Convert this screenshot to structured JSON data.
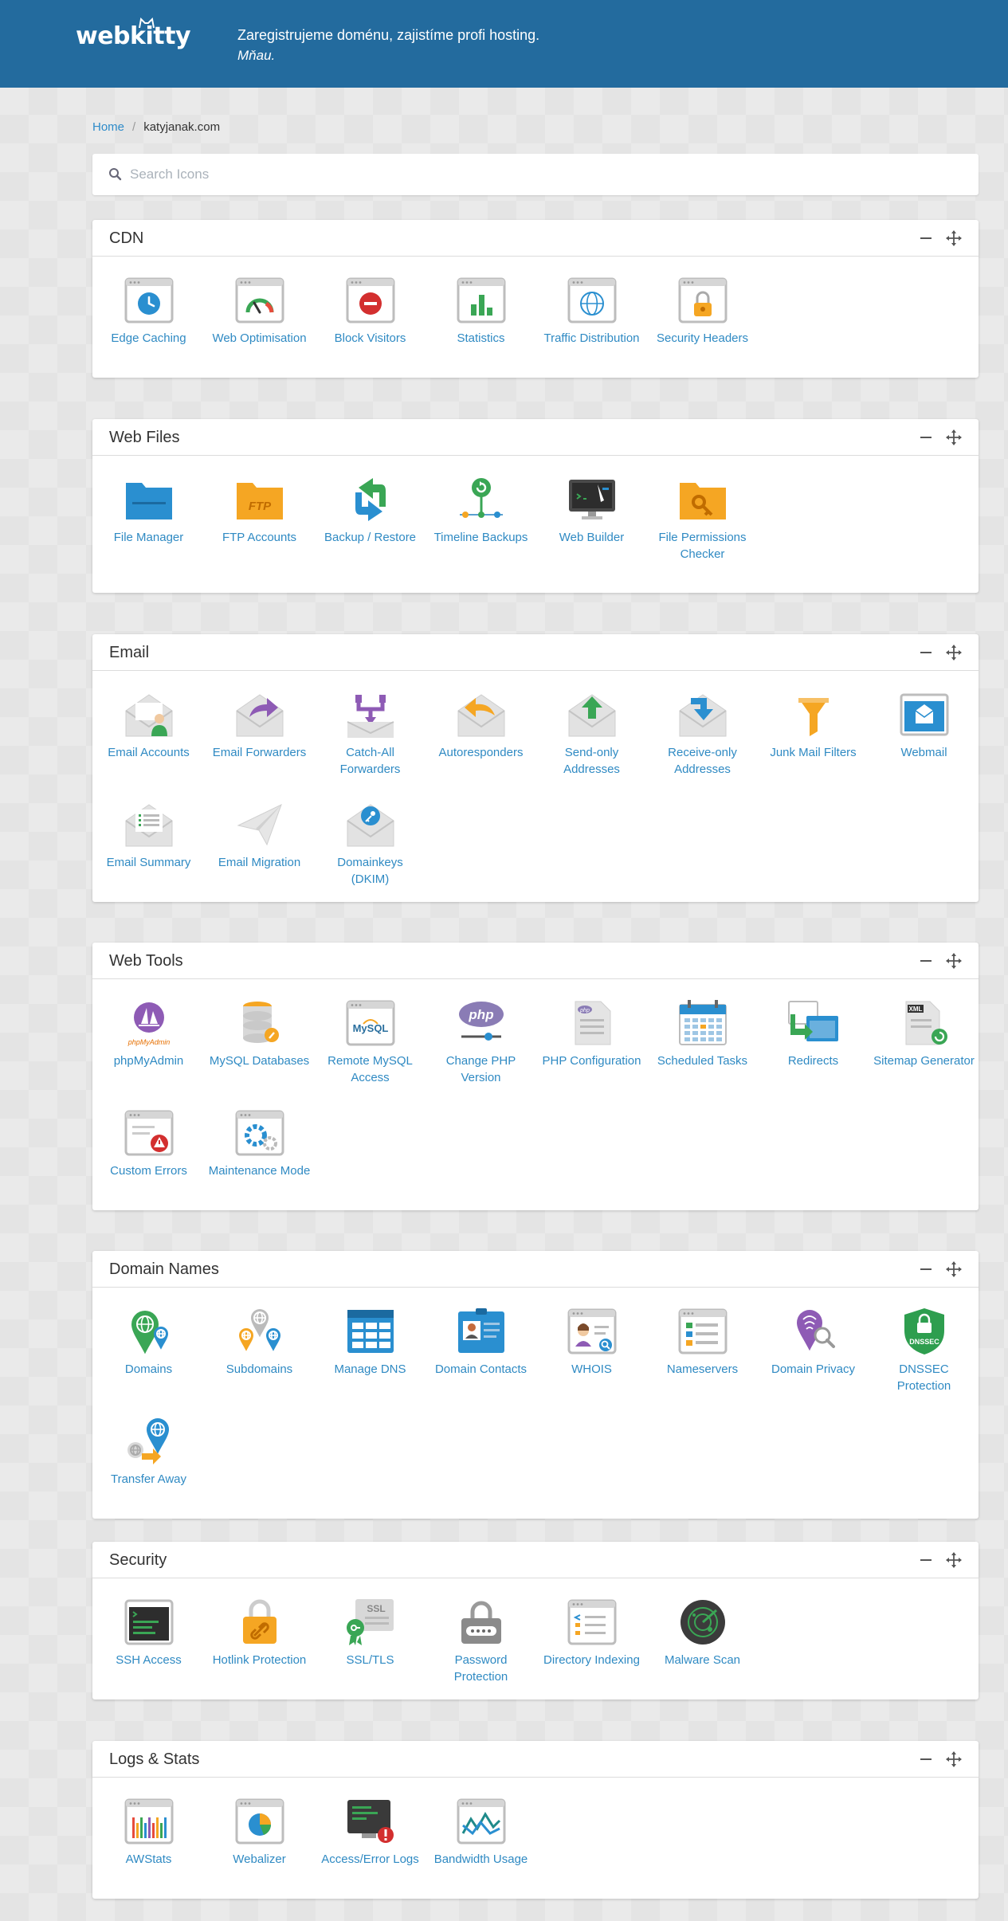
{
  "header": {
    "logo_text": "webkitty",
    "tagline_line1": "Zaregistrujeme doménu, zajistíme profi hosting.",
    "tagline_line2": "Mňau."
  },
  "breadcrumb": {
    "home": "Home",
    "current": "katyjanak.com"
  },
  "search": {
    "placeholder": "Search Icons",
    "value": ""
  },
  "sections": [
    {
      "title": "CDN",
      "items": [
        {
          "label": "Edge Caching",
          "icon": "edge-caching-icon"
        },
        {
          "label": "Web Optimisation",
          "icon": "web-optimisation-icon"
        },
        {
          "label": "Block Visitors",
          "icon": "block-visitors-icon"
        },
        {
          "label": "Statistics",
          "icon": "statistics-icon"
        },
        {
          "label": "Traffic Distribution",
          "icon": "traffic-distribution-icon"
        },
        {
          "label": "Security Headers",
          "icon": "security-headers-icon"
        }
      ]
    },
    {
      "title": "Web Files",
      "items": [
        {
          "label": "File Manager",
          "icon": "file-manager-icon"
        },
        {
          "label": "FTP Accounts",
          "icon": "ftp-accounts-icon"
        },
        {
          "label": "Backup / Restore",
          "icon": "backup-restore-icon"
        },
        {
          "label": "Timeline Backups",
          "icon": "timeline-backups-icon"
        },
        {
          "label": "Web Builder",
          "icon": "web-builder-icon"
        },
        {
          "label": "File Permissions Checker",
          "icon": "file-permissions-icon"
        }
      ]
    },
    {
      "title": "Email",
      "items": [
        {
          "label": "Email Accounts",
          "icon": "email-accounts-icon"
        },
        {
          "label": "Email Forwarders",
          "icon": "email-forwarders-icon"
        },
        {
          "label": "Catch-All Forwarders",
          "icon": "catch-all-icon"
        },
        {
          "label": "Autoresponders",
          "icon": "autoresponders-icon"
        },
        {
          "label": "Send-only Addresses",
          "icon": "send-only-icon"
        },
        {
          "label": "Receive-only Addresses",
          "icon": "receive-only-icon"
        },
        {
          "label": "Junk Mail Filters",
          "icon": "junk-mail-icon"
        },
        {
          "label": "Webmail",
          "icon": "webmail-icon"
        },
        {
          "label": "Email Summary",
          "icon": "email-summary-icon"
        },
        {
          "label": "Email Migration",
          "icon": "email-migration-icon"
        },
        {
          "label": "Domainkeys (DKIM)",
          "icon": "dkim-icon"
        }
      ]
    },
    {
      "title": "Web Tools",
      "items": [
        {
          "label": "phpMyAdmin",
          "icon": "phpmyadmin-icon",
          "icon_text": "phpMyAdmin"
        },
        {
          "label": "MySQL Databases",
          "icon": "mysql-databases-icon"
        },
        {
          "label": "Remote MySQL Access",
          "icon": "remote-mysql-icon",
          "icon_text": "MySQL"
        },
        {
          "label": "Change PHP Version",
          "icon": "php-version-icon",
          "icon_text": "php"
        },
        {
          "label": "PHP Configuration",
          "icon": "php-config-icon",
          "icon_text": "php"
        },
        {
          "label": "Scheduled Tasks",
          "icon": "scheduled-tasks-icon"
        },
        {
          "label": "Redirects",
          "icon": "redirects-icon"
        },
        {
          "label": "Sitemap Generator",
          "icon": "sitemap-icon",
          "icon_text": "XML"
        },
        {
          "label": "Custom Errors",
          "icon": "custom-errors-icon"
        },
        {
          "label": "Maintenance Mode",
          "icon": "maintenance-mode-icon"
        }
      ]
    },
    {
      "title": "Domain Names",
      "items": [
        {
          "label": "Domains",
          "icon": "domains-icon"
        },
        {
          "label": "Subdomains",
          "icon": "subdomains-icon"
        },
        {
          "label": "Manage DNS",
          "icon": "manage-dns-icon"
        },
        {
          "label": "Domain Contacts",
          "icon": "domain-contacts-icon"
        },
        {
          "label": "WHOIS",
          "icon": "whois-icon"
        },
        {
          "label": "Nameservers",
          "icon": "nameservers-icon"
        },
        {
          "label": "Domain Privacy",
          "icon": "domain-privacy-icon"
        },
        {
          "label": "DNSSEC Protection",
          "icon": "dnssec-icon",
          "icon_text": "DNSSEC"
        },
        {
          "label": "Transfer Away",
          "icon": "transfer-away-icon"
        }
      ]
    },
    {
      "title": "Security",
      "items": [
        {
          "label": "SSH Access",
          "icon": "ssh-access-icon"
        },
        {
          "label": "Hotlink Protection",
          "icon": "hotlink-icon"
        },
        {
          "label": "SSL/TLS",
          "icon": "ssl-tls-icon",
          "icon_text": "SSL"
        },
        {
          "label": "Password Protection",
          "icon": "password-protection-icon"
        },
        {
          "label": "Directory Indexing",
          "icon": "directory-indexing-icon"
        },
        {
          "label": "Malware Scan",
          "icon": "malware-scan-icon"
        }
      ]
    },
    {
      "title": "Logs & Stats",
      "items": [
        {
          "label": "AWStats",
          "icon": "awstats-icon"
        },
        {
          "label": "Webalizer",
          "icon": "webalizer-icon"
        },
        {
          "label": "Access/Error Logs",
          "icon": "access-error-logs-icon"
        },
        {
          "label": "Bandwidth Usage",
          "icon": "bandwidth-usage-icon"
        }
      ]
    }
  ],
  "colors": {
    "header_bg": "#236b9e",
    "link": "#2f8ac3",
    "page_bg": "#e4e4e4"
  }
}
